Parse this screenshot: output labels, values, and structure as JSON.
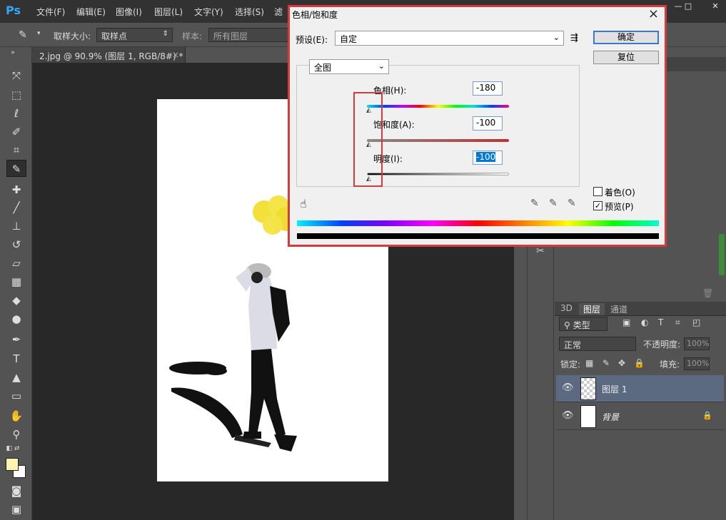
{
  "menu": {
    "logo": "Ps",
    "items": [
      "文件(F)",
      "编辑(E)",
      "图像(I)",
      "图层(L)",
      "文字(Y)",
      "选择(S)",
      "滤"
    ]
  },
  "options": {
    "sample_size_label": "取样大小:",
    "sample_size_value": "取样点",
    "sample_label": "样本:",
    "sample_value": "所有图层"
  },
  "document": {
    "tab_title": "2.jpg @ 90.9% (图层 1, RGB/8#) *",
    "tab_close": "×"
  },
  "dialog": {
    "title": "色相/饱和度",
    "close": "×",
    "preset_label": "预设(E):",
    "preset_value": "自定",
    "ok": "确定",
    "reset": "复位",
    "channel": "全图",
    "hue_label": "色相(H):",
    "hue_value": "-180",
    "saturation_label": "饱和度(A):",
    "saturation_value": "-100",
    "lightness_label": "明度(I):",
    "lightness_value": "-100",
    "colorize_label": "着色(O)",
    "colorize_checked": false,
    "preview_label": "预览(P)",
    "preview_checked": true
  },
  "layers_panel": {
    "tabs": [
      "3D",
      "图层",
      "通道"
    ],
    "filter_label": "类型",
    "blend_mode": "正常",
    "opacity_label": "不透明度:",
    "opacity_value": "100%",
    "lock_label": "锁定:",
    "fill_label": "填充:",
    "fill_value": "100%",
    "layers": [
      {
        "name": "图层 1",
        "selected": true
      },
      {
        "name": "背景",
        "selected": false,
        "locked": true
      }
    ]
  },
  "colors": {
    "foreground": "#fff3b0",
    "background": "#ffffff",
    "highlight": "#d43c3c"
  }
}
